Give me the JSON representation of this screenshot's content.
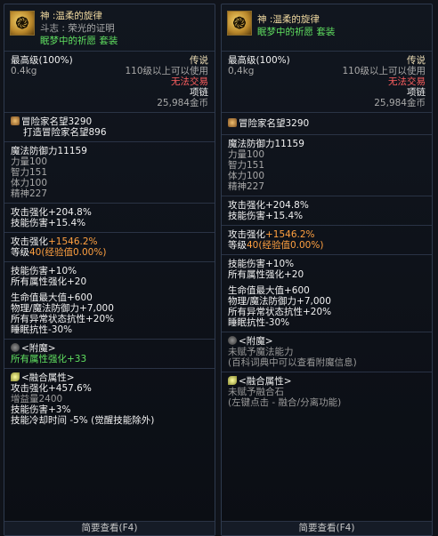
{
  "left": {
    "item": {
      "name": "神 :温柔的旋律",
      "subname": "斗志 : 荣光的证明",
      "set": "眠梦中的祈愿 套装",
      "icon": "swirl-item-icon"
    },
    "info": {
      "grade": "最高级(100%)",
      "rarity": "传说",
      "weight": "0.4kg",
      "level_req": "110级以上可以使用",
      "trade": "无法交易",
      "slot": "项链",
      "price": "25,984金币"
    },
    "fame": {
      "label": "冒险家名望3290",
      "sub": "打造冒险家名望896"
    },
    "stats": [
      "魔法防御力11159",
      "力量100",
      "智力151",
      "体力100",
      "精神227"
    ],
    "attack": [
      "攻击强化+204.8%",
      "技能伤害+15.4%"
    ],
    "growth": {
      "attack_prefix": "攻击强化",
      "attack_value": "+1546.2%",
      "level_prefix": "等级",
      "level_value": "40",
      "level_suffix": "(经验值0.00%)"
    },
    "options1": [
      "技能伤害+10%",
      "所有属性强化+20"
    ],
    "options2": [
      "生命值最大值+600",
      "物理/魔法防御力+7,000",
      "所有异常状态抗性+20%",
      "睡眠抗性-30%"
    ],
    "enchant": {
      "title": "<附魔>",
      "value": "所有属性强化+33"
    },
    "fusion": {
      "title": "<融合属性>",
      "lines": [
        "攻击强化+457.6%",
        "增益量2400",
        "技能伤害+3%",
        "技能冷却时间 -5% (觉醒技能除外)"
      ]
    },
    "footer": "简要查看(F4)"
  },
  "right": {
    "item": {
      "name": "神 :温柔的旋律",
      "set": "眠梦中的祈愿 套装",
      "icon": "swirl-item-icon"
    },
    "info": {
      "grade": "最高级(100%)",
      "rarity": "传说",
      "weight": "0,4kg",
      "level_req": "110级以上可以使用",
      "trade": "无法交易",
      "slot": "项链",
      "price": "25,984金币"
    },
    "fame": {
      "label": "冒险家名望3290"
    },
    "stats": [
      "魔法防御力11159",
      "力量100",
      "智力151",
      "体力100",
      "精神227"
    ],
    "attack": [
      "攻击强化+204.8%",
      "技能伤害+15.4%"
    ],
    "growth": {
      "attack_prefix": "攻击强化",
      "attack_value": "+1546.2%",
      "level_prefix": "等级",
      "level_value": "40",
      "level_suffix": "(经验值0.00%)"
    },
    "options1": [
      "技能伤害+10%",
      "所有属性强化+20"
    ],
    "options2": [
      "生命值最大值+600",
      "物理/魔法防御力+7,000",
      "所有异常状态抗性+20%",
      "睡眠抗性-30%"
    ],
    "enchant": {
      "title": "<附魔>",
      "lines": [
        "未赋予魔法能力",
        "(百科词典中可以查看附魔信息)"
      ]
    },
    "fusion": {
      "title": "<融合属性>",
      "lines": [
        "未赋予融合石",
        "(左键点击 - 融合/分离功能)"
      ]
    },
    "footer": "简要查看(F4)"
  },
  "colors": {
    "name": "#f0d9a0",
    "set": "#60e060",
    "trade": "#ff6060",
    "growth": "#ffa040",
    "border": "#2e3a4e"
  }
}
